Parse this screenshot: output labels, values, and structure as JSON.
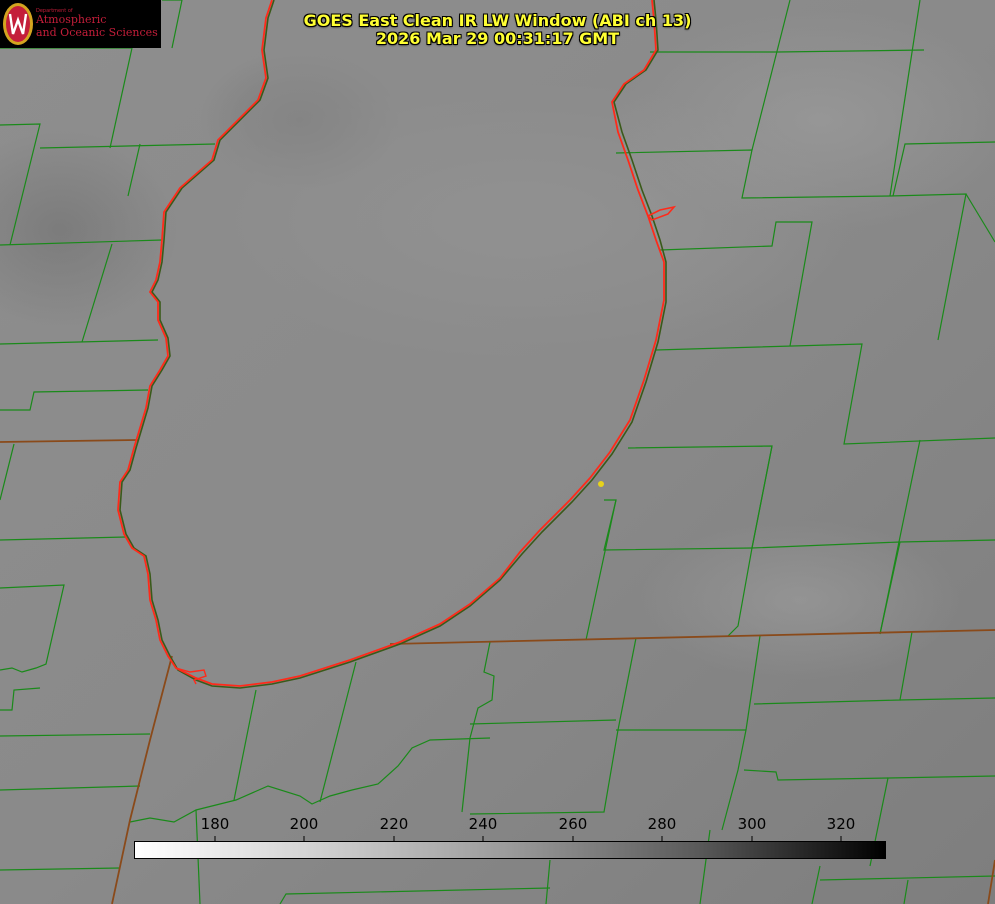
{
  "title": {
    "line1": "GOES East Clean IR LW Window (ABI ch 13)",
    "line2": "2026 Mar 29 00:31:17 GMT"
  },
  "logo": {
    "dept": "Department of",
    "line1": "Atmospheric",
    "line2": "and Oceanic Sciences",
    "icon": "uw-shield-icon"
  },
  "colorbar": {
    "ticks": [
      "180",
      "200",
      "220",
      "240",
      "260",
      "280",
      "300",
      "320"
    ],
    "tick_values": [
      180,
      200,
      220,
      240,
      260,
      280,
      300,
      320
    ],
    "range": [
      165,
      333
    ],
    "gradient": "white-to-black"
  },
  "colors": {
    "title": "#ffff33",
    "county_lines": "#1a8a1a",
    "shoreline": "#ff2a1a",
    "logo_text": "#c41e3a",
    "marker": "#e6d21a"
  }
}
